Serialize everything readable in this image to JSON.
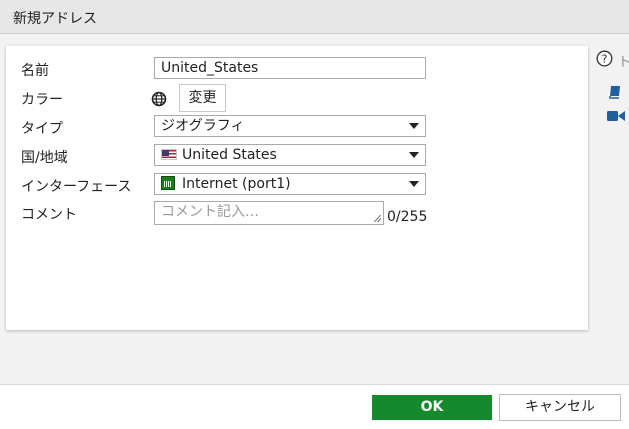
{
  "window": {
    "title": "新規アドレス"
  },
  "form": {
    "name_label": "名前",
    "name_value": "United_States",
    "color_label": "カラー",
    "color_button": "変更",
    "type_label": "タイプ",
    "type_value": "ジオグラフィ",
    "country_label": "国/地域",
    "country_value": "United States",
    "interface_label": "インターフェース",
    "interface_value": "Internet (port1)",
    "comment_label": "コメント",
    "comment_placeholder": "コメント記入…",
    "comment_counter": "0/255"
  },
  "side": {
    "help_text": "ト"
  },
  "footer": {
    "ok_label": "OK",
    "cancel_label": "キャンセル"
  },
  "colors": {
    "ok_green": "#158a2d",
    "port_green": "#1e7b1e",
    "book_blue": "#1f5f9e"
  },
  "icons": [
    "globe-icon",
    "help-icon",
    "book-icon",
    "video-icon",
    "us-flag-icon",
    "port-icon",
    "chevron-down-icon"
  ]
}
